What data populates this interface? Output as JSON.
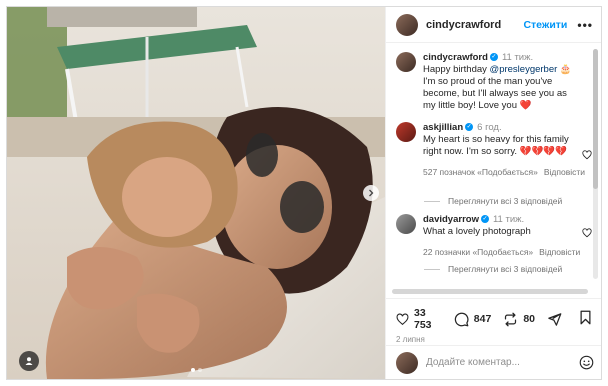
{
  "post": {
    "username": "cindycrawford",
    "follow_label": "Стежити",
    "more_label": "•••",
    "caption": {
      "username": "cindycrawford",
      "time": "11 тиж.",
      "text_before": "Happy birthday ",
      "mention": "@presleygerber",
      "text_after": " 🎂 I'm so proud of the man you've become, but I'll always see you as my little boy! Love you ❤️"
    }
  },
  "comments": [
    {
      "username": "askjillian",
      "verified": true,
      "time": "6 год.",
      "text": "My heart is so heavy for this family right now. I'm so sorry. 💔💔💔💔",
      "likes": "527 позначок «Подобається»",
      "reply": "Відповісти",
      "view_replies": "Переглянути всі 3 відповідей"
    },
    {
      "username": "davidyarrow",
      "verified": true,
      "time": "11 тиж.",
      "text": "What a lovely photograph",
      "likes": "22 позначки «Подобається»",
      "reply": "Відповісти",
      "view_replies": "Переглянути всі 3 відповідей"
    }
  ],
  "stats": {
    "likes": "33 753",
    "comments": "847",
    "reposts": "80",
    "date": "2 липня"
  },
  "add_comment": {
    "placeholder": "Додайте коментар..."
  },
  "icons": {
    "like": "heart-icon",
    "comment": "comment-icon",
    "repost": "repost-icon",
    "share": "share-icon",
    "save": "bookmark-icon",
    "emoji": "emoji-icon",
    "next": "chevron-right-icon",
    "tags": "user-tag-icon"
  }
}
